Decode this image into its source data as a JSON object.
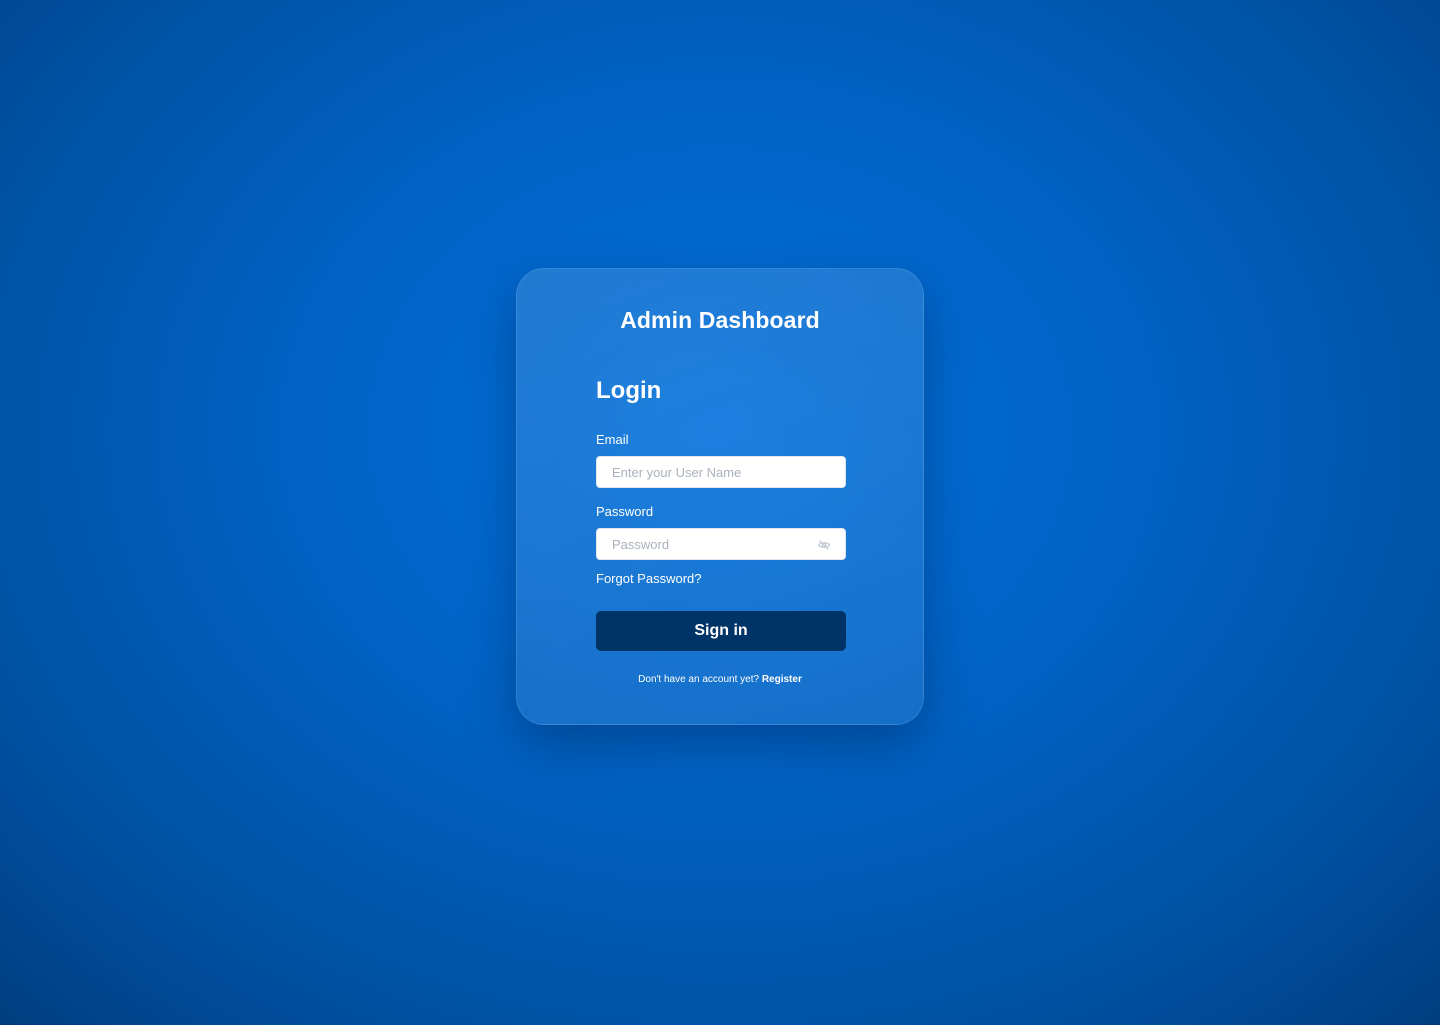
{
  "app": {
    "title": "Admin Dashboard"
  },
  "login": {
    "heading": "Login",
    "email_label": "Email",
    "email_placeholder": "Enter your User Name",
    "email_value": "",
    "password_label": "Password",
    "password_placeholder": "Password",
    "password_value": "",
    "password_toggle_icon": "eye-off-icon",
    "forgot_link": "Forgot Password?",
    "submit_label": "Sign in",
    "register_prompt": "Don't have an account yet?",
    "register_link": "Register"
  },
  "colors": {
    "background": "#0067cc",
    "button": "#003366",
    "text": "#ffffff"
  }
}
